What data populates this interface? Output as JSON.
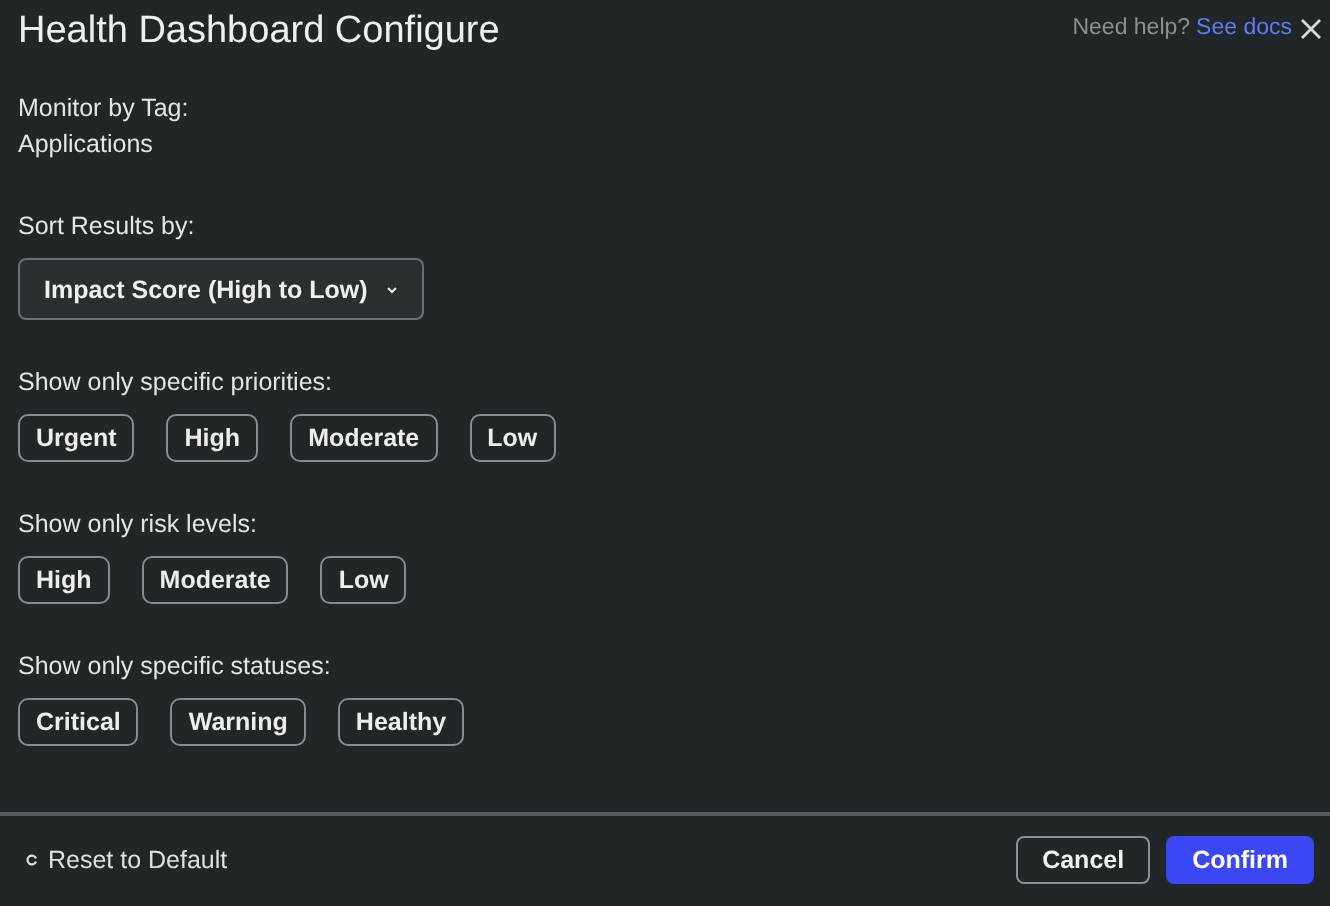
{
  "dialog": {
    "title": "Health Dashboard Configure",
    "help_text": "Need help?",
    "help_link": "See docs"
  },
  "monitor": {
    "label": "Monitor by Tag:",
    "value": "Applications"
  },
  "sort": {
    "label": "Sort Results by:",
    "value": "Impact Score (High to Low)"
  },
  "filter_groups": [
    {
      "label": "Show only specific priorities:",
      "chips": [
        {
          "label": "Urgent",
          "selected": false
        },
        {
          "label": "High",
          "selected": false
        },
        {
          "label": "Moderate",
          "selected": false
        },
        {
          "label": "Low",
          "selected": false
        }
      ]
    },
    {
      "label": "Show only risk levels:",
      "chips": [
        {
          "label": "High",
          "selected": false
        },
        {
          "label": "Moderate",
          "selected": false
        },
        {
          "label": "Low",
          "selected": false
        }
      ]
    },
    {
      "label": "Show only specific statuses:",
      "chips": [
        {
          "label": "Critical",
          "selected": false
        },
        {
          "label": "Warning",
          "selected": false
        },
        {
          "label": "Healthy",
          "selected": false
        }
      ]
    }
  ],
  "footer": {
    "reset": "Reset to Default",
    "buttons": [
      {
        "label": "Cancel",
        "kind": "secondary"
      },
      {
        "label": "Confirm",
        "kind": "primary"
      }
    ]
  }
}
